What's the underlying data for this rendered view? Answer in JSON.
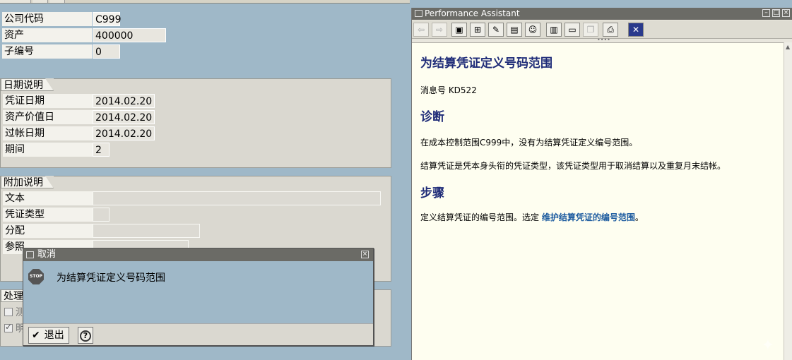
{
  "header_fields": [
    {
      "label": "公司代码",
      "value": "C999"
    },
    {
      "label": "资产",
      "value": "400000"
    },
    {
      "label": "子编号",
      "value": "0"
    }
  ],
  "date_group": {
    "title": "日期说明",
    "fields": [
      {
        "label": "凭证日期",
        "value": "2014.02.20"
      },
      {
        "label": "资产价值日",
        "value": "2014.02.20"
      },
      {
        "label": "过帐日期",
        "value": "2014.02.20"
      },
      {
        "label": "期间",
        "value": "2"
      }
    ]
  },
  "additional_group": {
    "title": "附加说明",
    "fields": [
      {
        "label": "文本",
        "value": ""
      },
      {
        "label": "凭证类型",
        "value": ""
      },
      {
        "label": "分配",
        "value": ""
      },
      {
        "label": "参照",
        "value": ""
      }
    ]
  },
  "processing_group": {
    "title": "处理",
    "options": [
      {
        "label": "测",
        "checked": false
      },
      {
        "label": "明",
        "checked": true
      }
    ]
  },
  "performance_assistant": {
    "window_title": "Performance Assistant",
    "heading": "为结算凭证定义号码范围",
    "message_number": "消息号  KD522",
    "diagnosis_heading": "诊断",
    "diagnosis_text_1": "在成本控制范围C999中，没有为结算凭证定义编号范围。",
    "diagnosis_text_2": "结算凭证是凭本身头衔的凭证类型，该凭证类型用于取消结算以及重复月末结帐。",
    "procedure_heading": "步骤",
    "procedure_text": "定义结算凭证的编号范围。选定 ",
    "procedure_link": "维护结算凭证的编号范围",
    "procedure_text_end": "。"
  },
  "cancel_dialog": {
    "title": "取消",
    "message": "为结算凭证定义号码范围",
    "exit_label": "退出",
    "stop_text": "STOP"
  },
  "colors": {
    "background": "#9fb8c8",
    "title_bar": "#6b6b66",
    "heading_blue": "#1f2c78",
    "link_blue": "#1f5da0"
  }
}
